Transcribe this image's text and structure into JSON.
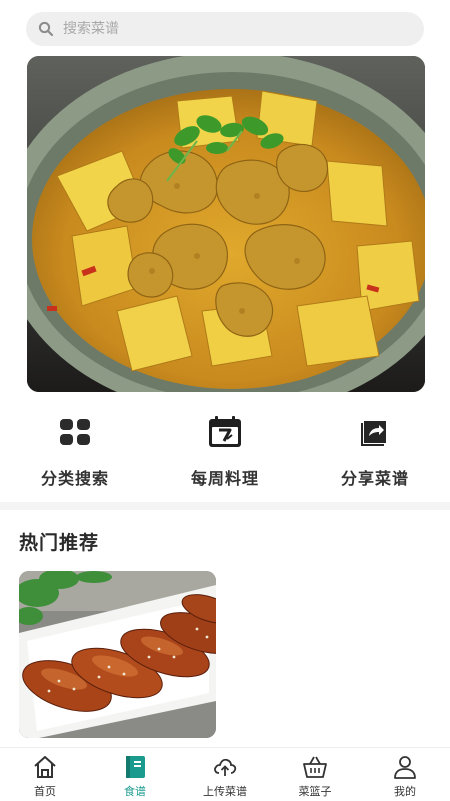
{
  "search": {
    "placeholder": "搜索菜谱",
    "icon": "search-icon"
  },
  "features": [
    {
      "label": "分类搜索",
      "icon": "grid-icon"
    },
    {
      "label": "每周料理",
      "icon": "calendar-icon"
    },
    {
      "label": "分享菜谱",
      "icon": "share-icon"
    }
  ],
  "section": {
    "title": "热门推荐"
  },
  "tabs": [
    {
      "label": "首页",
      "icon": "home-icon"
    },
    {
      "label": "食谱",
      "icon": "book-icon"
    },
    {
      "label": "上传菜谱",
      "icon": "upload-cloud-icon"
    },
    {
      "label": "菜篮子",
      "icon": "basket-icon"
    },
    {
      "label": "我的",
      "icon": "user-icon"
    }
  ],
  "active_tab": "食谱",
  "colors": {
    "accent": "#1a9b8e",
    "text": "#333333",
    "search_bg": "#efefef"
  }
}
